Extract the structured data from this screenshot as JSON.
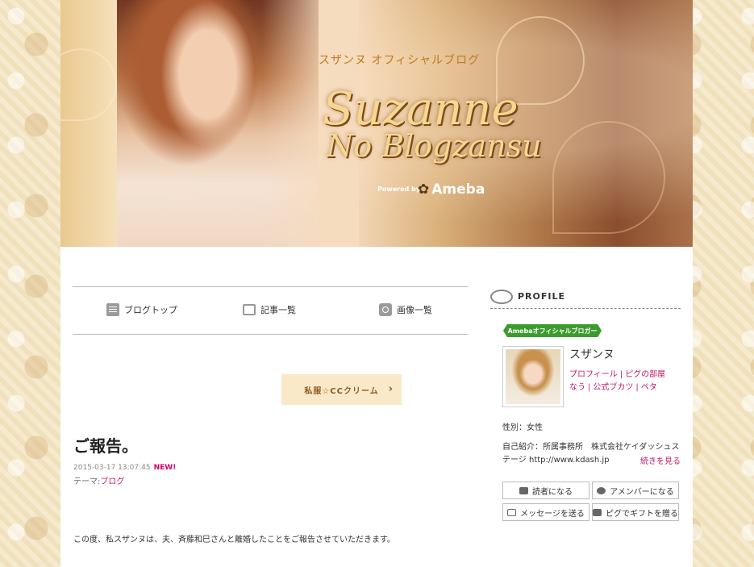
{
  "header": {
    "subtitle": "スザンヌ オフィシャルブログ",
    "title_line1": "Suzanne",
    "title_line2": "No Blogzansu",
    "powered_by": "Powered by",
    "ameba_logo": "Ameba"
  },
  "nav": {
    "items": [
      {
        "label": "ブログトップ",
        "icon": "document-icon"
      },
      {
        "label": "記事一覧",
        "icon": "list-icon"
      },
      {
        "label": "画像一覧",
        "icon": "camera-icon"
      }
    ]
  },
  "theme_button": {
    "label": "私服☆CCクリーム",
    "icon": "chevron-right-icon"
  },
  "article": {
    "title": "ご報告。",
    "datetime": "2015-03-17 13:07:45",
    "new_badge": "NEW!",
    "theme_prefix": "テーマ:",
    "theme": "ブログ",
    "body": "この度、私スザンヌは、夫、斉藤和巳さんと離婚したことをご報告させていただきます。"
  },
  "profile": {
    "heading": "PROFILE",
    "badge": "Amebaオフィシャルブロガー",
    "name": "スザンヌ",
    "links": [
      "プロフィール",
      "ピグの部屋",
      "なう",
      "公式ブカツ",
      "ペタ"
    ],
    "gender": "性別：女性",
    "intro": "自己紹介：所属事務所　株式会社ケイダッシュステージ http://www.kdash.jp",
    "more": "続きを見る",
    "actions": [
      {
        "label": "読者になる",
        "icon": "reader-icon"
      },
      {
        "label": "アメンバーになる",
        "icon": "member-icon"
      },
      {
        "label": "メッセージを送る",
        "icon": "mail-icon"
      },
      {
        "label": "ピグでギフトを贈る",
        "icon": "gift-icon"
      }
    ]
  },
  "colors": {
    "accent": "#c2186a",
    "badge_green": "#3b9b2e",
    "theme_bg": "#fae9c8"
  }
}
